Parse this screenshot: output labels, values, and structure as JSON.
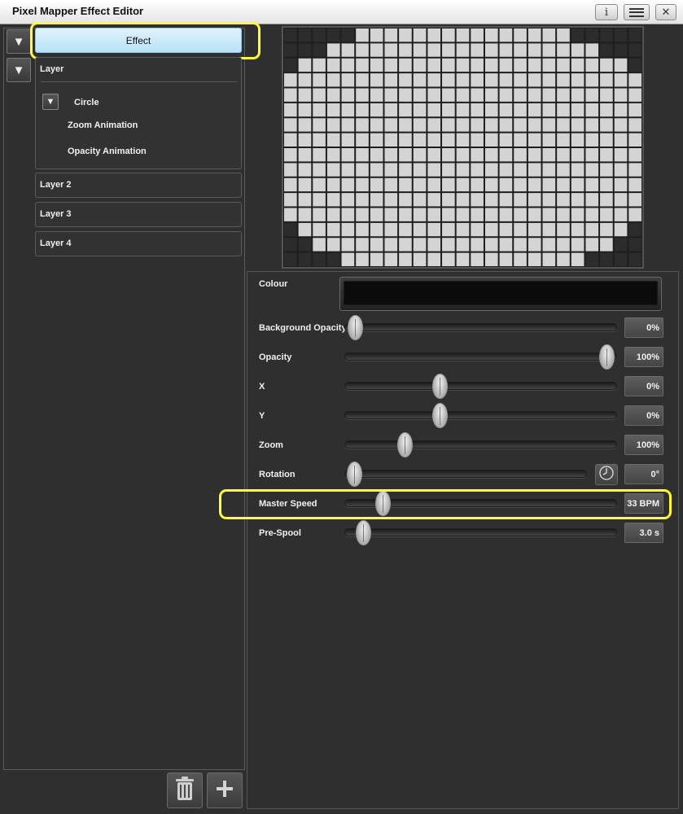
{
  "window": {
    "title": "Pixel Mapper Effect Editor",
    "info_label": "i",
    "close_label": "✕"
  },
  "tree": {
    "effect_label": "Effect",
    "layers": [
      {
        "label": "Layer",
        "shape": {
          "label": "Circle",
          "animations": [
            "Zoom Animation",
            "Opacity Animation"
          ]
        }
      },
      {
        "label": "Layer 2"
      },
      {
        "label": "Layer 3"
      },
      {
        "label": "Layer 4"
      }
    ]
  },
  "preview": {
    "columns": 25,
    "rows": 16,
    "lit_color": "#d4d4d4",
    "dark_color": "#2c2c2c"
  },
  "properties": {
    "colour": {
      "label": "Colour",
      "value": "#0b0b0b"
    },
    "background_opacity": {
      "label": "Background Opacity",
      "value": "0%",
      "slider_fraction": 0.04
    },
    "opacity": {
      "label": "Opacity",
      "value": "100%",
      "slider_fraction": 0.96
    },
    "x": {
      "label": "X",
      "value": "0%",
      "slider_fraction": 0.35
    },
    "y": {
      "label": "Y",
      "value": "0%",
      "slider_fraction": 0.35
    },
    "zoom": {
      "label": "Zoom",
      "value": "100%",
      "slider_fraction": 0.22
    },
    "rotation": {
      "label": "Rotation",
      "value": "0°",
      "slider_fraction": 0.04
    },
    "master_speed": {
      "label": "Master Speed",
      "value": "33 BPM",
      "slider_fraction": 0.14
    },
    "pre_spool": {
      "label": "Pre-Spool",
      "value": "3.0 s",
      "slider_fraction": 0.07
    }
  },
  "highlight_color": "#ffff33",
  "selected_color": "#b8e2f6"
}
